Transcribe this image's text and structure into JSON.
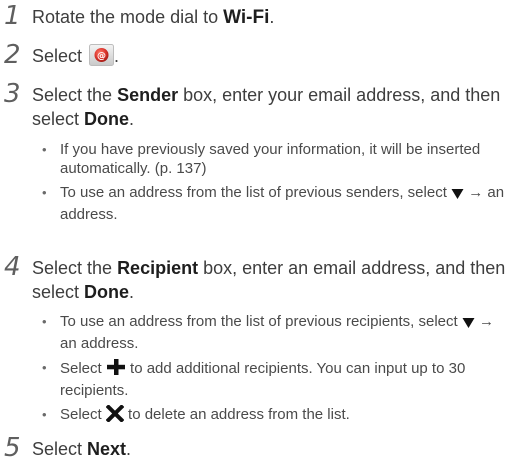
{
  "steps": [
    {
      "num": "1",
      "pre": "Rotate the mode dial to ",
      "bold": "Wi-Fi",
      "post": "."
    },
    {
      "num": "2",
      "pre": "Select ",
      "icon": "email-app-icon",
      "post": "."
    },
    {
      "num": "3",
      "pre": "Select the ",
      "bold": "Sender",
      "mid": " box, enter your email address, and then select ",
      "bold2": "Done",
      "post": ".",
      "bullets": [
        {
          "text": "If you have previously saved your information, it will be inserted automatically. (p. 137)"
        },
        {
          "pre": "To use an address from the list of previous senders, select ",
          "icon": "down-triangle-icon",
          "post": " → an address."
        }
      ]
    },
    {
      "num": "4",
      "pre": "Select the ",
      "bold": "Recipient",
      "mid": " box, enter an email address, and then select ",
      "bold2": "Done",
      "post": ".",
      "bullets": [
        {
          "pre": "To use an address from the list of previous recipients, select ",
          "icon": "down-triangle-icon",
          "post": " → an address."
        },
        {
          "pre": "Select ",
          "icon": "plus-icon",
          "post": " to add additional recipients. You can input up to 30 recipients."
        },
        {
          "pre": "Select ",
          "icon": "x-icon",
          "post": " to delete an address from the list."
        }
      ]
    },
    {
      "num": "5",
      "pre": "Select ",
      "bold": "Next",
      "post": "."
    }
  ],
  "colors": {
    "text": "#3e3e3e",
    "number": "#5f5f5f",
    "icon_red": "#d9322a",
    "symbol": "#111111"
  }
}
